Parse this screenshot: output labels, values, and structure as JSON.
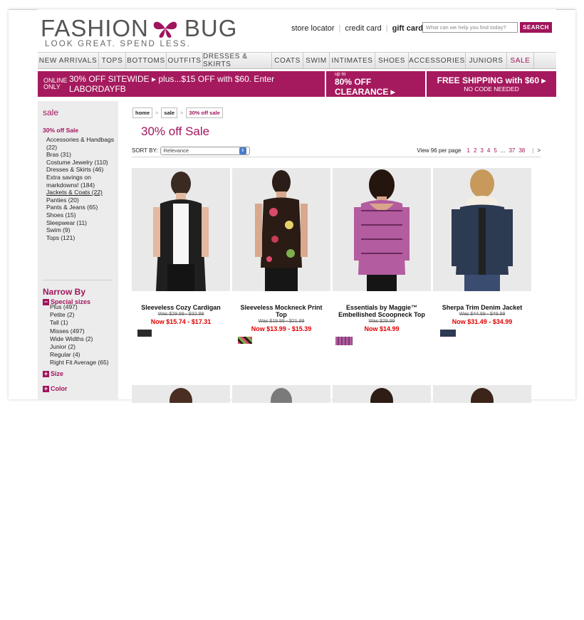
{
  "header": {
    "brand_left": "FASHION",
    "brand_right": "BUG",
    "tagline": "LOOK GREAT. SPEND LESS.",
    "links": [
      "store locator",
      "credit card",
      "gift cards"
    ],
    "search_placeholder": "What can we help you find today?",
    "search_button": "SEARCH"
  },
  "nav": [
    "NEW ARRIVALS",
    "TOPS",
    "BOTTOMS",
    "OUTFITS",
    "DRESSES & SKIRTS",
    "COATS",
    "SWIM",
    "INTIMATES",
    "SHOES",
    "ACCESSORIES",
    "JUNIORS",
    "SALE"
  ],
  "promo": {
    "online": "ONLINE ONLY",
    "sitewide": "30% OFF SITEWIDE ▸ plus...$15 OFF with $60. Enter LABORDAYFB",
    "upto": "up to",
    "clearance": "80% OFF CLEARANCE ▸",
    "shipping": "FREE SHIPPING with $60 ▸",
    "shipping_sub": "NO CODE NEEDED"
  },
  "sidebar": {
    "title": "sale",
    "current": "30% off Sale",
    "categories": [
      "Accessories & Handbags (22)",
      "Bras (31)",
      "Costume Jewelry (110)",
      "Dresses & Skirts (46)",
      "Extra savings on markdowns! (184)",
      "Jackets & Coats (22)",
      "Panties (20)",
      "Pants & Jeans (65)",
      "Shoes (15)",
      "Sleepwear (11)",
      "Swim (9)",
      "Tops (121)"
    ],
    "narrow_by": "Narrow By",
    "special_sizes": "Special sizes",
    "sizes": [
      "Plus (497)",
      "Petite (2)",
      "Tall (1)",
      "Misses (497)",
      "Wide Widths (2)",
      "Junior (2)",
      "Regular (4)",
      "Right Fit Average (65)"
    ],
    "size": "Size",
    "color": "Color",
    "minus_glyph": "−",
    "plus_glyph": "+"
  },
  "breadcrumb": [
    "home",
    "sale",
    "30% off sale"
  ],
  "page_title": "30% off Sale",
  "sort": {
    "label": "SORT BY:",
    "value": "Relevance",
    "view_label": "View 96 per page",
    "pages": [
      "1",
      "2",
      "3",
      "4",
      "5"
    ],
    "dots": "...",
    "last_pages": [
      "37",
      "38"
    ],
    "next": ">"
  },
  "products": [
    {
      "name": "Sleeveless Cozy Cardigan",
      "was": "Was $29.99 - $32.99",
      "now": "Now $15.74 - $17.31",
      "swatch_color": "#2a2a2a"
    },
    {
      "name": "Sleeveless Mockneck Print Top",
      "was": "Was $19.99 - $21.99",
      "now": "Now $13.99 - $15.39",
      "swatch_color": "#6b3b2a"
    },
    {
      "name": "Essentials by Maggie™ Embellished Scoopneck Top",
      "was": "Was $29.99",
      "now": "Now $14.99",
      "swatch_color": "#b35ca0"
    },
    {
      "name": "Sherpa Trim Denim Jacket",
      "was": "Was $44.99 - $49.99",
      "now": "Now $31.49 - $34.99",
      "swatch_color": "#2c3a52"
    }
  ]
}
